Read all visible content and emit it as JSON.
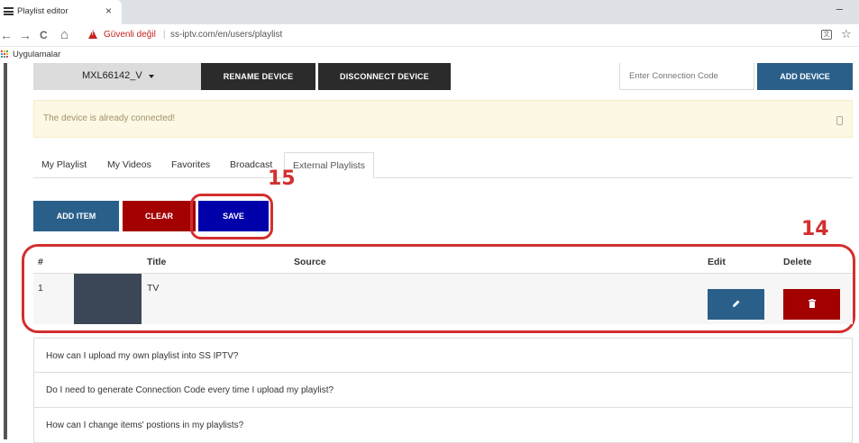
{
  "browser": {
    "tab_title": "Playlist editor",
    "tab_close": "×",
    "window_minimize": "–",
    "back": "←",
    "forward": "→",
    "reload": "C",
    "home": "⌂",
    "security_label": "Güvenli değil",
    "separator": "|",
    "url": "ss-iptv.com/en/users/playlist",
    "translate_glyph": "文",
    "star": "☆",
    "bookmark_label": "Uygulamalar",
    "apps_colors": [
      "#ea4335",
      "#fbbc05",
      "#34a853",
      "#4285f4",
      "#ea4335",
      "#fbbc05",
      "#34a853",
      "#4285f4",
      "#ea4335"
    ]
  },
  "device": {
    "selected": "MXL66142_V",
    "rename_label": "RENAME DEVICE",
    "disconnect_label": "DISCONNECT DEVICE",
    "connection_placeholder": "Enter Connection Code",
    "add_device_label": "ADD DEVICE"
  },
  "alert": {
    "message": "The device is already connected!"
  },
  "tabs": [
    {
      "label": "My Playlist"
    },
    {
      "label": "My Videos"
    },
    {
      "label": "Favorites"
    },
    {
      "label": "Broadcast"
    },
    {
      "label": "External Playlists",
      "active": true
    }
  ],
  "actions": {
    "add_item_label": "ADD ITEM",
    "clear_label": "CLEAR",
    "save_label": "SAVE"
  },
  "annotations": {
    "save_number": "15",
    "table_number": "14",
    "color": "#d32f2f"
  },
  "table": {
    "headers": {
      "index": "#",
      "title": "Title",
      "source": "Source",
      "edit": "Edit",
      "delete": "Delete"
    },
    "rows": [
      {
        "index": "1",
        "title": "TV",
        "source": "",
        "edit_icon": "pencil-icon",
        "delete_icon": "trash-icon"
      }
    ]
  },
  "faq": [
    {
      "question": "How can I upload my own playlist into SS IPTV?"
    },
    {
      "question": "Do I need to generate Connection Code every time I upload my playlist?"
    },
    {
      "question": "How can I change items' postions in my playlists?"
    }
  ],
  "colors": {
    "primary_blue": "#2a5f8a",
    "danger_red": "#a30000",
    "save_blue": "#0000aa",
    "dark_button": "#2b2b2b"
  }
}
